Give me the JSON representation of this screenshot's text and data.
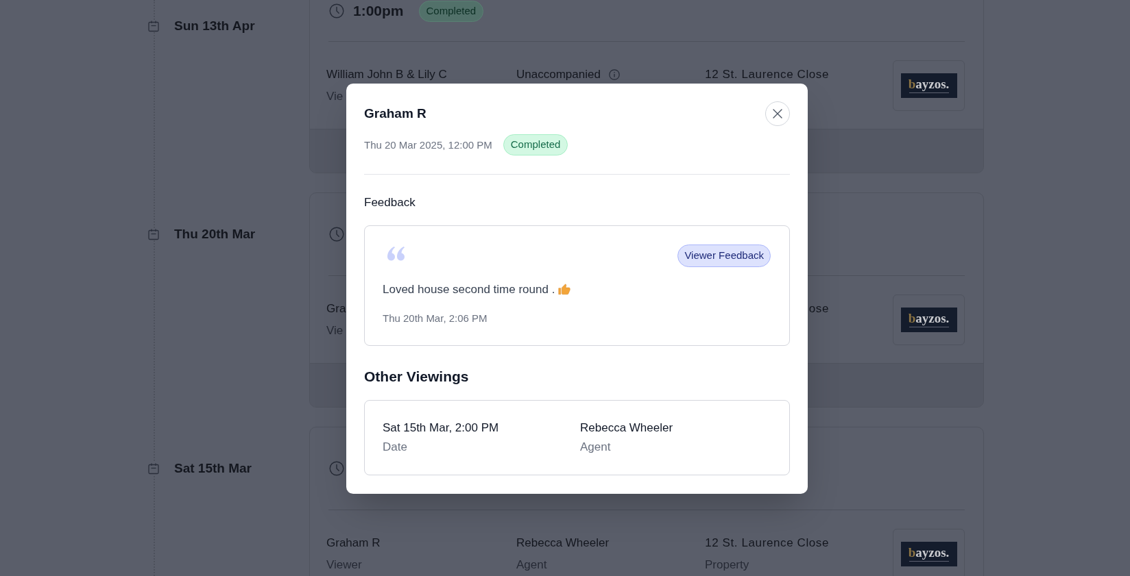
{
  "timeline": [
    {
      "date": "Sun 13th Apr",
      "viewing": {
        "time": "1:00pm",
        "status": "Completed",
        "details": {
          "viewer": {
            "value": "William John B & Lily C",
            "label": "Vie"
          },
          "agent": {
            "value": "Unaccompanied",
            "info": true
          },
          "property": {
            "value": "12 St. Laurence Close"
          }
        },
        "agency_logo": {
          "wordmark": "bayzos."
        }
      }
    },
    {
      "date": "Thu 20th Mar",
      "viewing": {
        "details": {
          "viewer": {
            "value": "Gra",
            "label": "Vie"
          },
          "property": {
            "value": "ose"
          }
        },
        "agency_logo": {
          "wordmark": "bayzos."
        }
      }
    },
    {
      "date": "Sat 15th Mar",
      "viewing": {
        "details": {
          "viewer": {
            "value": "Graham R",
            "label": "Viewer"
          },
          "agent": {
            "value": "Rebecca Wheeler",
            "label": "Agent",
            "info": false
          },
          "property": {
            "value": "12 St. Laurence Close",
            "label": "Property"
          }
        },
        "agency_logo": {
          "wordmark": "bayzos."
        }
      }
    }
  ],
  "viewing_dialog": {
    "title": "Graham R",
    "datetime": "Thu 20 Mar 2025, 12:00 PM",
    "status": "Completed",
    "feedback_heading": "Feedback",
    "feedback": [
      {
        "tag": "Viewer Feedback",
        "text": "Loved house second time round .",
        "timestamp": "Thu 20th Mar, 2:06 PM"
      }
    ],
    "other_viewings_heading": "Other Viewings",
    "other_viewings": [
      {
        "date": "Sat 15th Mar, 2:00 PM",
        "date_label": "Date",
        "agent": "Rebecca Wheeler",
        "agent_label": "Agent"
      }
    ]
  }
}
